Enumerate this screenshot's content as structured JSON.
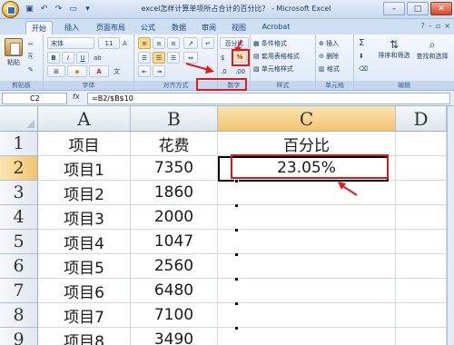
{
  "window": {
    "title": "excel怎样计算单项所占合计的百分比？ - Microsoft Excel"
  },
  "tabs": [
    "开始",
    "插入",
    "页面布局",
    "公式",
    "数据",
    "审阅",
    "视图",
    "Acrobat"
  ],
  "active_tab": "开始",
  "ribbon": {
    "clipboard": {
      "paste": "粘贴",
      "group": "剪贴板"
    },
    "font": {
      "font_name": "宋体",
      "font_size": "11",
      "bold": "B",
      "italic": "I",
      "underline": "U",
      "grow": "A",
      "font_color": "A",
      "group": "字体"
    },
    "alignment": {
      "group": "对齐方式"
    },
    "number": {
      "format": "百分比",
      "percent": "%",
      "group": "数字"
    },
    "styles": {
      "conditional": "条件格式",
      "table": "套用表格格式",
      "cell": "单元格样式",
      "group": "样式"
    },
    "cells": {
      "insert": "插入",
      "delete": "删除",
      "format": "格式",
      "group": "单元格"
    },
    "editing": {
      "sum": "Σ",
      "sort": "排序和筛选",
      "find": "查找和选择",
      "group": "编辑"
    }
  },
  "formula_bar": {
    "name_box": "C2",
    "fx": "fx",
    "formula": "=B2/$B$10"
  },
  "sheet": {
    "columns": [
      "A",
      "B",
      "C",
      "D"
    ],
    "rows": [
      "1",
      "2",
      "3",
      "4",
      "5",
      "6",
      "7",
      "8",
      "9"
    ],
    "cells": [
      [
        "项目",
        "花费",
        "百分比"
      ],
      [
        "项目1",
        "7350",
        "23.05%"
      ],
      [
        "项目2",
        "1860",
        ""
      ],
      [
        "项目3",
        "2000",
        ""
      ],
      [
        "项目4",
        "1047",
        ""
      ],
      [
        "项目5",
        "2560",
        ""
      ],
      [
        "项目6",
        "6480",
        ""
      ],
      [
        "项目7",
        "7100",
        ""
      ],
      [
        "项目8",
        "3490",
        ""
      ]
    ],
    "selected_cell": "C2"
  },
  "colors": {
    "annotation": "#e01b1b",
    "selection_header": "#f3c46e"
  }
}
